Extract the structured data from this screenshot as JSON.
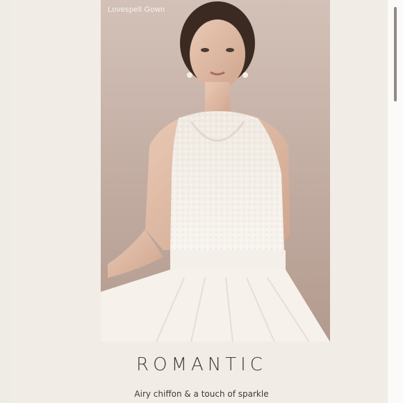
{
  "hero": {
    "caption": "Lovespell Gown"
  },
  "content": {
    "headline": "ROMANTIC",
    "subhead": "Airy chiffon & a touch of sparkle"
  },
  "colors": {
    "background": "#f4f2ee",
    "photo_backdrop": "#c6b1a6",
    "gown": "#f2ede6",
    "text": "#3d3a37"
  }
}
